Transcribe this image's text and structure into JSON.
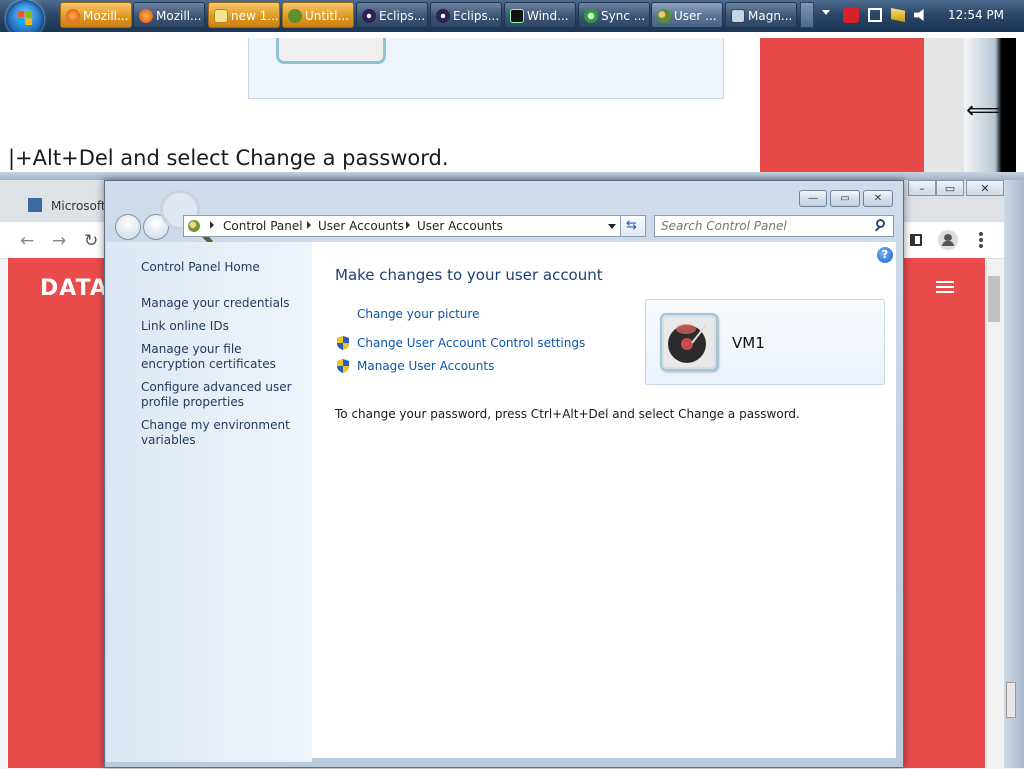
{
  "taskbar": {
    "buttons": [
      {
        "label": "Mozill...",
        "style": "orange",
        "icon": "firefox-icon"
      },
      {
        "label": "Mozill...",
        "style": "gray",
        "icon": "firefox-icon"
      },
      {
        "label": "new 1...",
        "style": "orange",
        "icon": "notepad-icon"
      },
      {
        "label": "Untitl...",
        "style": "orange",
        "icon": "paint-icon"
      },
      {
        "label": "Eclips...",
        "style": "gray",
        "icon": "eclipse-icon"
      },
      {
        "label": "Eclips...",
        "style": "gray",
        "icon": "eclipse-icon"
      },
      {
        "label": "Wind...",
        "style": "gray",
        "icon": "terminal-icon"
      },
      {
        "label": "Sync ...",
        "style": "gray",
        "icon": "sync-icon"
      },
      {
        "label": "User ...",
        "style": "gray",
        "icon": "users-icon"
      },
      {
        "label": "Magn...",
        "style": "gray",
        "icon": "magnifier-icon"
      }
    ],
    "clock": "12:54 PM"
  },
  "background": {
    "top_text": "|+Alt+Del and select Change a password.",
    "browser_tab": "Microsoft",
    "page_brand": "DATA"
  },
  "window": {
    "breadcrumb": [
      "Control Panel",
      "User Accounts",
      "User Accounts"
    ],
    "search_placeholder": "Search Control Panel",
    "help_label": "?"
  },
  "sidebar": {
    "items": [
      {
        "label": "Control Panel Home"
      },
      {
        "label": "Manage your credentials"
      },
      {
        "label": "Link online IDs"
      },
      {
        "label": "Manage your file encryption certificates"
      },
      {
        "label": "Configure advanced user profile properties"
      },
      {
        "label": "Change my environment variables"
      }
    ]
  },
  "main": {
    "heading": "Make changes to your user account",
    "links": [
      {
        "label": "Change your picture",
        "shield": false
      },
      {
        "label": "Change User Account Control settings",
        "shield": true
      },
      {
        "label": "Manage User Accounts",
        "shield": true
      }
    ],
    "user_name": "VM1",
    "note": "To change your password, press Ctrl+Alt+Del and select Change a password."
  }
}
